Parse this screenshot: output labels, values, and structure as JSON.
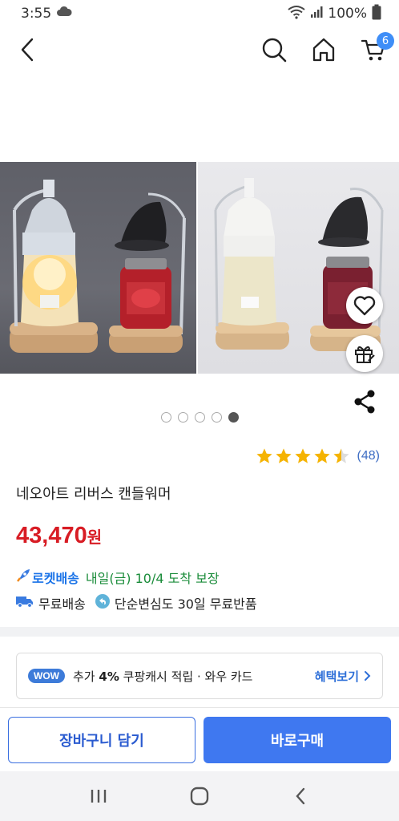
{
  "status_bar": {
    "time": "3:55",
    "battery": "100%"
  },
  "nav": {
    "cart_count": "6"
  },
  "gallery": {
    "dot_count": 5,
    "active_index": 4
  },
  "product": {
    "rating": 4.5,
    "review_count": "(48)",
    "title": "네오아트 리버스 캔들워머",
    "price": "43,470",
    "price_unit": "원"
  },
  "delivery": {
    "rocket_label": "로켓배송",
    "eta": "내일(금) 10/4 도착 보장"
  },
  "benefits": {
    "free_shipping": "무료배송",
    "return_policy": "단순변심도 30일 무료반품"
  },
  "wow": {
    "badge": "WOW",
    "text_prefix": "추가",
    "percent": "4%",
    "text_suffix": "쿠팡캐시 적립  ·  와우 카드",
    "link": "혜택보기"
  },
  "actions": {
    "add_to_cart": "장바구니 담기",
    "buy_now": "바로구매"
  },
  "colors": {
    "price": "#d81c24",
    "accent_blue": "#3f78f0",
    "rocket_green": "#1a8c3a",
    "star": "#f5b301"
  }
}
